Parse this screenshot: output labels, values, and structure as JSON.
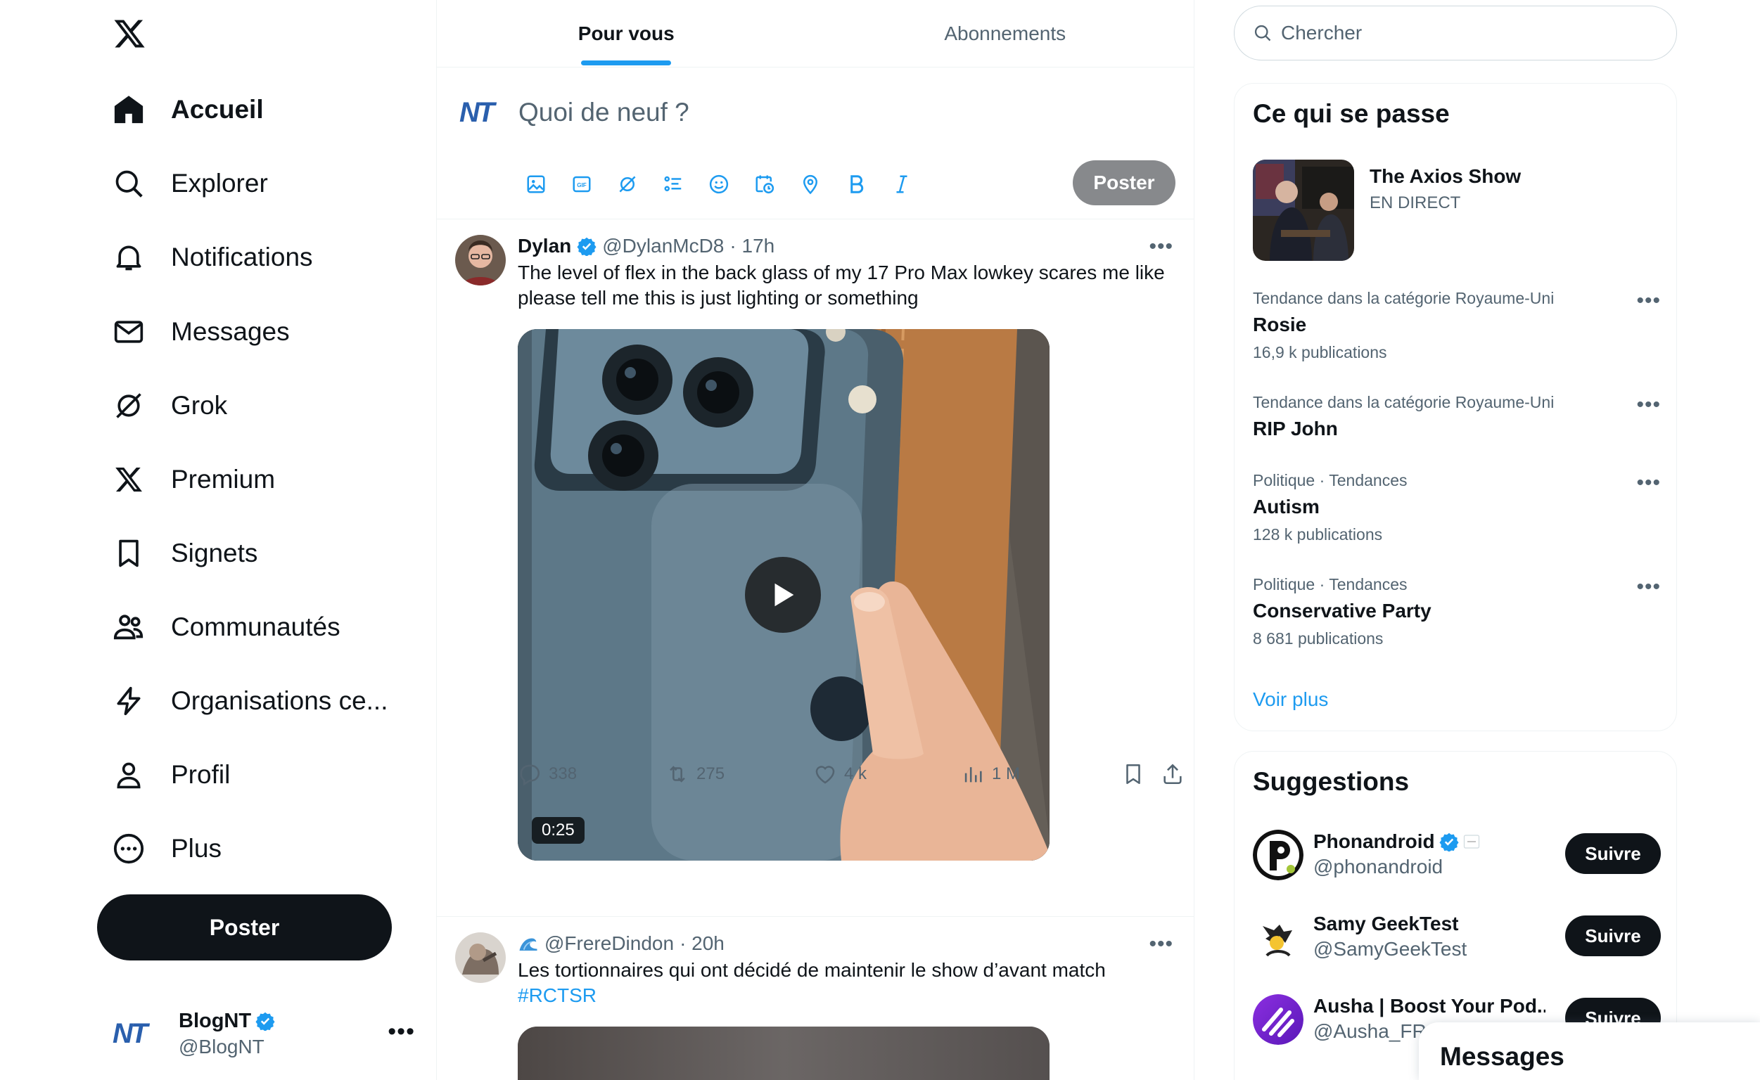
{
  "nav": {
    "items": [
      {
        "label": "Accueil",
        "icon": "home-icon"
      },
      {
        "label": "Explorer",
        "icon": "search-icon"
      },
      {
        "label": "Notifications",
        "icon": "bell-icon"
      },
      {
        "label": "Messages",
        "icon": "mail-icon"
      },
      {
        "label": "Grok",
        "icon": "grok-icon"
      },
      {
        "label": "Premium",
        "icon": "x-icon"
      },
      {
        "label": "Signets",
        "icon": "bookmark-icon"
      },
      {
        "label": "Communautés",
        "icon": "people-icon"
      },
      {
        "label": "Organisations ce...",
        "icon": "lightning-icon"
      },
      {
        "label": "Profil",
        "icon": "person-icon"
      },
      {
        "label": "Plus",
        "icon": "more-circle-icon"
      }
    ],
    "post_button": "Poster"
  },
  "account": {
    "logo": "NT",
    "name": "BlogNT",
    "handle": "@BlogNT"
  },
  "tabs": [
    {
      "label": "Pour vous",
      "active": true
    },
    {
      "label": "Abonnements",
      "active": false
    }
  ],
  "composer": {
    "logo": "NT",
    "placeholder": "Quoi de neuf ?",
    "post_button": "Poster",
    "tools": [
      "image-icon",
      "gif-icon",
      "grok-icon",
      "poll-icon",
      "emoji-icon",
      "schedule-icon",
      "location-icon",
      "bold-icon",
      "italic-icon"
    ]
  },
  "tweets": [
    {
      "name": "Dylan",
      "verified": true,
      "handle": "@DylanMcD8",
      "time": "· 17h",
      "text": "The level of flex in the back glass of my 17 Pro Max lowkey scares me like please tell me this is just lighting or something",
      "video_duration": "0:25",
      "stats": {
        "replies": "338",
        "reposts": "275",
        "likes": "4 k",
        "views": "1 M"
      }
    },
    {
      "name": "",
      "handle": "@FrereDindon",
      "time": "· 20h",
      "text": "Les tortionnaires qui ont décidé de maintenir le show d’avant match",
      "hashtag": "#RCTSR"
    }
  ],
  "search": {
    "placeholder": "Chercher"
  },
  "trends_panel": {
    "title": "Ce qui se passe",
    "live": {
      "title": "The Axios Show",
      "status": "EN DIRECT"
    },
    "trends": [
      {
        "category": "Tendance dans la catégorie Royaume-Uni",
        "name": "Rosie",
        "count": "16,9 k publications"
      },
      {
        "category": "Tendance dans la catégorie Royaume-Uni",
        "name": "RIP John",
        "count": ""
      },
      {
        "category": "Politique · Tendances",
        "name": "Autism",
        "count": "128 k publications"
      },
      {
        "category": "Politique · Tendances",
        "name": "Conservative Party",
        "count": "8 681 publications"
      }
    ],
    "see_more": "Voir plus"
  },
  "suggestions_panel": {
    "title": "Suggestions",
    "follow_label": "Suivre",
    "users": [
      {
        "name": "Phonandroid",
        "handle": "@phonandroid",
        "verified": true
      },
      {
        "name": "Samy GeekTest",
        "handle": "@SamyGeekTest",
        "verified": false
      },
      {
        "name": "Ausha | Boost Your Pod...",
        "handle": "@Ausha_FR",
        "verified": false
      }
    ]
  },
  "messages_drawer": {
    "title": "Messages"
  },
  "colors": {
    "accent": "#1d9bf0",
    "text": "#0f1419",
    "muted": "#536471",
    "border": "#eff3f4",
    "nt_blue": "#2a5fad"
  }
}
